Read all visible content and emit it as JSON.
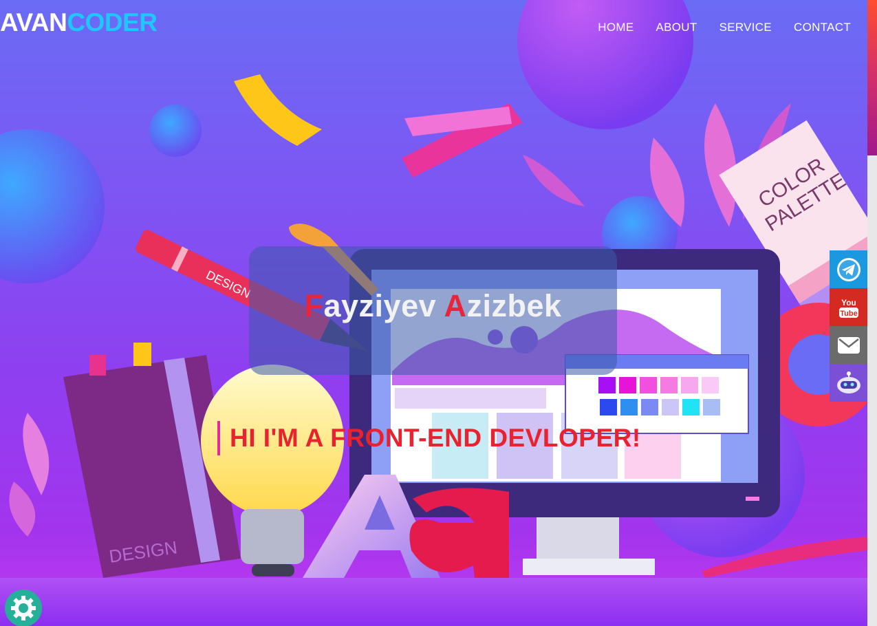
{
  "header": {
    "logo_part1": "AVAN",
    "logo_part2": "CODER",
    "nav": [
      "HOME",
      "ABOUT",
      "SERVICE",
      "CONTACT"
    ]
  },
  "hero": {
    "name_first_initial": "F",
    "name_first_rest": "ayziyev ",
    "name_last_initial": "A",
    "name_last_rest": "zizbek",
    "tagline": "HI I'M A FRONT-END DEVLOPER!",
    "illustration": {
      "pen_label": "DESIGN",
      "book_label": "DESIGN",
      "palette_label_line1": "COLOR",
      "palette_label_line2": "PALETTE",
      "letters": "Aa"
    }
  },
  "social": [
    {
      "name": "telegram",
      "icon": "telegram-icon",
      "color": "#1a99e0"
    },
    {
      "name": "youtube",
      "icon": "youtube-icon",
      "color": "#d42a21",
      "label_top": "You",
      "label_bottom": "Tube"
    },
    {
      "name": "email",
      "icon": "mail-icon",
      "color": "#6b6b6b"
    },
    {
      "name": "bot",
      "icon": "robot-icon",
      "color": "#7b4fd6"
    }
  ],
  "settings": {
    "icon": "gear-icon",
    "color": "#25b09a"
  },
  "colors": {
    "accent_red": "#e8263b",
    "logo_cyan": "#1ec8ff",
    "tag_bar": "#e5289c"
  }
}
